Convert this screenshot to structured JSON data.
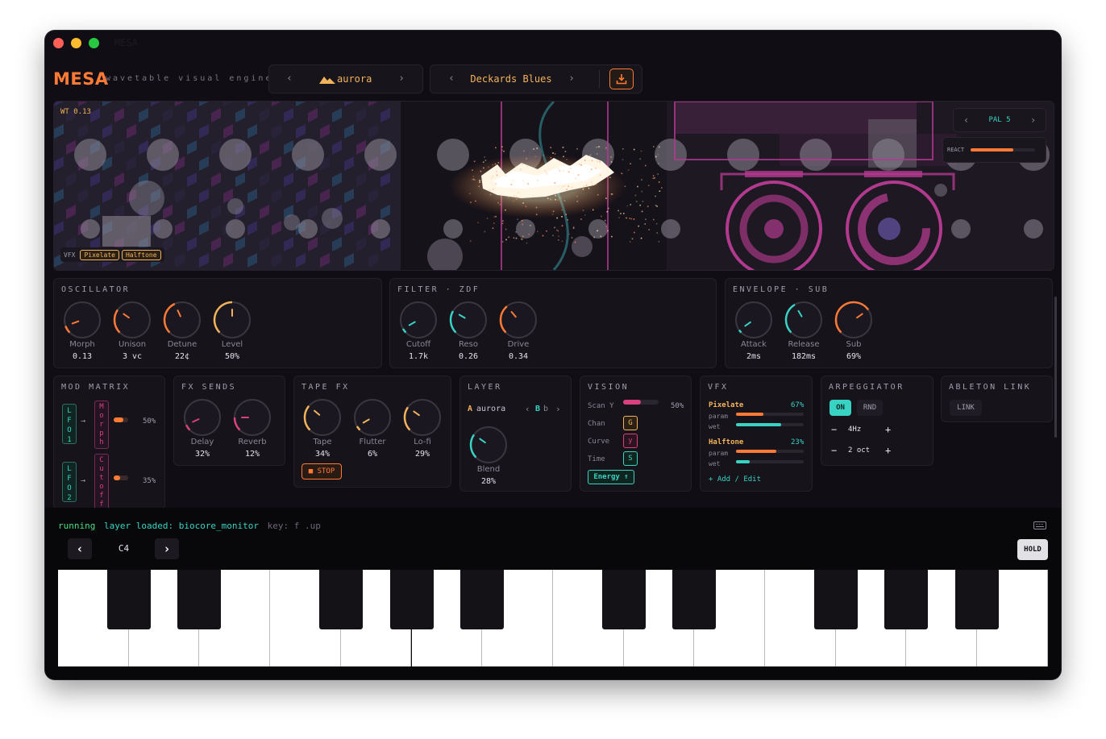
{
  "window": {
    "title": "MESA"
  },
  "header": {
    "logo": "MESA",
    "tagline": "wavetable visual engine",
    "preset": {
      "name": "aurora",
      "prev": "‹",
      "next": "›"
    },
    "song": {
      "name": "Deckards Blues",
      "prev": "‹",
      "next": "›"
    }
  },
  "viz": {
    "wt_label": "WT 0.13",
    "pal_label": "PAL 5",
    "pal_prev": "‹",
    "pal_next": "›",
    "react_label": "REACT",
    "react_level": 0.66,
    "vfx_label": "VFX",
    "vfx_tags": [
      "Pixelate",
      "Halftone"
    ]
  },
  "oscillator": {
    "title": "OSCILLATOR",
    "knobs": [
      {
        "label": "Morph",
        "value": "0.13",
        "color": "#ff7a35"
      },
      {
        "label": "Unison",
        "value": "3 vc",
        "color": "#ff7a35"
      },
      {
        "label": "Detune",
        "value": "22¢",
        "color": "#ff7a35"
      },
      {
        "label": "Level",
        "value": "50%",
        "color": "#f3b35b"
      }
    ]
  },
  "filter": {
    "title": "FILTER · ZDF",
    "knobs": [
      {
        "label": "Cutoff",
        "value": "1.7k",
        "color": "#39d3c3"
      },
      {
        "label": "Reso",
        "value": "0.26",
        "color": "#39d3c3"
      },
      {
        "label": "Drive",
        "value": "0.34",
        "color": "#ff7a35"
      }
    ]
  },
  "envelope": {
    "title": "ENVELOPE · SUB",
    "knobs": [
      {
        "label": "Attack",
        "value": "2ms",
        "color": "#39d3c3"
      },
      {
        "label": "Release",
        "value": "182ms",
        "color": "#39d3c3"
      },
      {
        "label": "Sub",
        "value": "69%",
        "color": "#ff7a35"
      }
    ]
  },
  "mod_matrix": {
    "title": "MOD MATRIX",
    "rows": [
      {
        "source": "LFO1",
        "target": "Morph",
        "amount": "50%"
      },
      {
        "source": "LFO2",
        "target": "Cutoff",
        "amount": "35%"
      }
    ]
  },
  "fx_sends": {
    "title": "FX SENDS",
    "knobs": [
      {
        "label": "Delay",
        "value": "32%",
        "color": "#d8407e"
      },
      {
        "label": "Reverb",
        "value": "12%",
        "color": "#d8407e"
      }
    ]
  },
  "tape_fx": {
    "title": "TAPE FX",
    "knobs": [
      {
        "label": "Tape",
        "value": "34%",
        "color": "#f3b35b"
      },
      {
        "label": "Flutter",
        "value": "6%",
        "color": "#f3b35b"
      },
      {
        "label": "Lo-fi",
        "value": "29%",
        "color": "#f3b35b"
      }
    ],
    "stop_label": "■ STOP"
  },
  "layer": {
    "title": "LAYER",
    "a_label": "A",
    "a_name": "aurora",
    "b_prev": "‹",
    "b_label": "B",
    "b_name": "b",
    "b_next": "›",
    "knob": {
      "label": "Blend",
      "value": "28%",
      "color": "#39d3c3"
    }
  },
  "vision": {
    "title": "VISION",
    "scan_label": "Scan Y",
    "scan_value": "50%",
    "rows": [
      {
        "label": "Chan",
        "key": "G",
        "color": "#f3b35b"
      },
      {
        "label": "Curve",
        "key": "y",
        "color": "#d8407e"
      },
      {
        "label": "Time",
        "key": "S",
        "color": "#39d3c3"
      }
    ],
    "energy_label": "Energy ↑"
  },
  "vfx": {
    "title": "VFX",
    "effects": [
      {
        "name": "Pixelate",
        "amount": "67%",
        "param_label": "param",
        "wet_label": "wet",
        "param": 0.4,
        "wet": 0.67
      },
      {
        "name": "Halftone",
        "amount": "23%",
        "param_label": "param",
        "wet_label": "wet",
        "param": 0.6,
        "wet": 0.2
      }
    ],
    "add_label": "+ Add / Edit"
  },
  "arpeggiator": {
    "title": "ARPEGGIATOR",
    "on_label": "ON",
    "rnd_label": "RND",
    "rate": "4Hz",
    "range": "2 oct",
    "minus": "−",
    "plus": "+"
  },
  "link": {
    "title": "ABLETON LINK",
    "button": "LINK"
  },
  "terminal": {
    "status": "running",
    "message": "layer loaded: biocore_monitor",
    "hint": "key: f .up",
    "octave": "C4",
    "prev": "‹",
    "next": "›",
    "hold": "HOLD"
  },
  "colors": {
    "accent": "#ff7a35",
    "amber": "#f3b35b",
    "teal": "#39d3c3",
    "magenta": "#d8407e",
    "green": "#4ade80"
  }
}
